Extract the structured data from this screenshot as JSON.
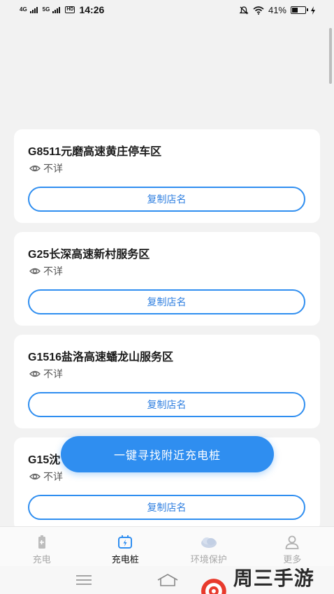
{
  "status_bar": {
    "net1": "4G",
    "net2": "5G",
    "hd": "HD",
    "time": "14:26",
    "battery": "41%",
    "battery_level": 0.41
  },
  "stations": [
    {
      "name": "G8511元磨高速黄庄停车区",
      "status": "不详",
      "copy_label": "复制店名"
    },
    {
      "name": "G25长深高速新村服务区",
      "status": "不详",
      "copy_label": "复制店名"
    },
    {
      "name": "G1516盐洛高速蟠龙山服务区",
      "status": "不详",
      "copy_label": "复制店名"
    },
    {
      "name": "G15沈",
      "status": "不详",
      "copy_label": "复制店名"
    }
  ],
  "fab_label": "一键寻找附近充电桩",
  "tabs": [
    {
      "label": "充电",
      "icon": "battery-icon",
      "active": false
    },
    {
      "label": "充电桩",
      "icon": "charging-pile-icon",
      "active": true
    },
    {
      "label": "环境保护",
      "icon": "cloud-icon",
      "active": false
    },
    {
      "label": "更多",
      "icon": "user-icon",
      "active": false
    }
  ],
  "watermark": "周三手游网",
  "colors": {
    "accent": "#2f8ef0",
    "background": "#f2f2f2",
    "card": "#ffffff"
  }
}
